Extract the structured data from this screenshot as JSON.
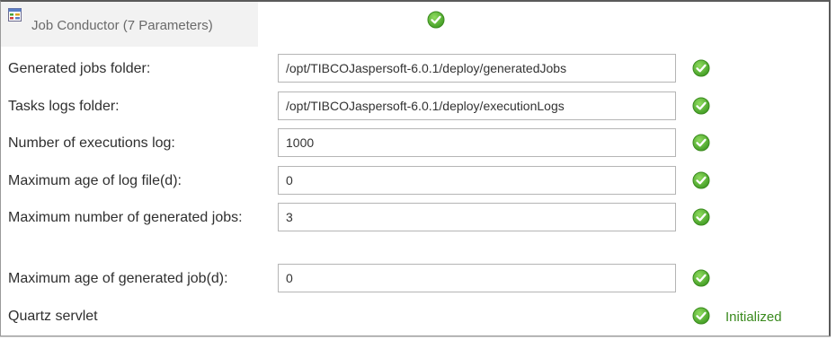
{
  "panel": {
    "title": "Job Conductor (7 Parameters)",
    "icon": "grid-table-icon",
    "status_icon": "check-circle-icon"
  },
  "params": [
    {
      "label": "Generated jobs folder:",
      "value": "/opt/TIBCOJaspersoft-6.0.1/deploy/generatedJobs"
    },
    {
      "label": "Tasks logs folder:",
      "value": "/opt/TIBCOJaspersoft-6.0.1/deploy/executionLogs"
    },
    {
      "label": "Number of executions log:",
      "value": "1000"
    },
    {
      "label": "Maximum age of log file(d):",
      "value": "0"
    },
    {
      "label": "Maximum number of generated jobs:",
      "value": "3"
    },
    {
      "label": "Maximum age of generated job(d):",
      "value": "0"
    }
  ],
  "quartz": {
    "label": "Quartz servlet",
    "status": "Initialized"
  },
  "colors": {
    "check_green": "#5cb531",
    "status_text": "#3a8a1e"
  }
}
